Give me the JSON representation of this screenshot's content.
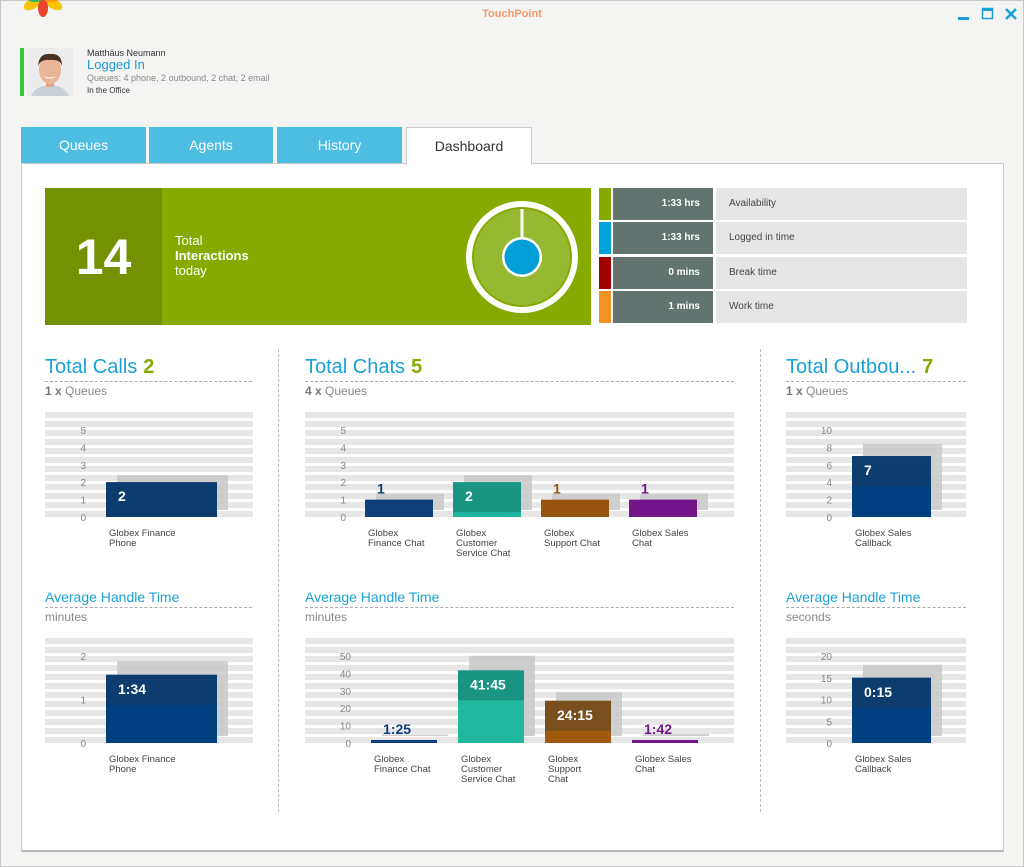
{
  "app": {
    "title": "TouchPoint"
  },
  "window_controls": {
    "minimize": "minimize",
    "maximize": "maximize",
    "close": "close"
  },
  "profile": {
    "name": "Matthäus Neumann",
    "status": "Logged In",
    "queues": "Queues: 4 phone, 2 outbound, 2 chat, 2 email",
    "location": "In the Office",
    "status_color": "#35c83a"
  },
  "tabs": [
    {
      "label": "Queues",
      "active": false
    },
    {
      "label": "Agents",
      "active": false
    },
    {
      "label": "History",
      "active": false
    },
    {
      "label": "Dashboard",
      "active": true
    }
  ],
  "summary": {
    "total": "14",
    "label_line1": "Total",
    "label_line2": "Interactions",
    "label_line3": "today",
    "color": "#86aa00"
  },
  "times": [
    {
      "value": "1:33 hrs",
      "label": "Availability",
      "color": "#86aa00"
    },
    {
      "value": "1:33 hrs",
      "label": "Logged in time",
      "color": "#00a3d9"
    },
    {
      "value": "0 mins",
      "label": "Break time",
      "color": "#a30000"
    },
    {
      "value": "1 mins",
      "label": "Work time",
      "color": "#f39323"
    }
  ],
  "sections": {
    "calls": {
      "title": "Total Calls",
      "count": "2",
      "queues_count": "1 x",
      "queues_label": "Queues",
      "aht_title": "Average Handle Time",
      "aht_unit": "minutes"
    },
    "chats": {
      "title": "Total Chats",
      "count": "5",
      "queues_count": "4 x",
      "queues_label": "Queues",
      "aht_title": "Average Handle Time",
      "aht_unit": "minutes"
    },
    "outbound": {
      "title": "Total Outbou...",
      "count": "7",
      "queues_count": "1 x",
      "queues_label": "Queues",
      "aht_title": "Average Handle Time",
      "aht_unit": "seconds"
    }
  },
  "chart_data": [
    {
      "id": "calls-count",
      "type": "bar",
      "title": "Total Calls",
      "categories": [
        "Globex Finance Phone"
      ],
      "labels": [
        [
          "Globex Finance",
          "Phone"
        ]
      ],
      "values": [
        2
      ],
      "value_labels": [
        "2"
      ],
      "colors": [
        "#0d3c6e"
      ],
      "colors_light": [
        "#0d3c6e"
      ],
      "ylim": [
        0,
        6
      ],
      "yticks": [
        0,
        1,
        2,
        3,
        4,
        5
      ],
      "label_inside": [
        true
      ]
    },
    {
      "id": "chats-count",
      "type": "bar",
      "title": "Total Chats",
      "categories": [
        "Globex Finance Chat",
        "Globex Customer Service Chat",
        "Globex Support Chat",
        "Globex Sales Chat"
      ],
      "labels": [
        [
          "Globex",
          "Finance Chat"
        ],
        [
          "Globex",
          "Customer",
          "Service Chat"
        ],
        [
          "Globex",
          "Support Chat"
        ],
        [
          "Globex Sales",
          "Chat"
        ]
      ],
      "values": [
        1,
        2,
        1,
        1
      ],
      "value_labels": [
        "1",
        "2",
        "1",
        "1"
      ],
      "colors": [
        "#0f3f78",
        "#1a9482",
        "#98550f",
        "#73168b"
      ],
      "colors_light": [
        "#0f3f78",
        "#1fb89f",
        "#98550f",
        "#73168b"
      ],
      "ylim": [
        0,
        6
      ],
      "yticks": [
        0,
        1,
        2,
        3,
        4,
        5
      ],
      "label_inside": [
        false,
        true,
        false,
        false
      ]
    },
    {
      "id": "outbound-count",
      "type": "bar",
      "title": "Total Outbound",
      "categories": [
        "Globex Sales Callback"
      ],
      "labels": [
        [
          "Globex Sales",
          "Callback"
        ]
      ],
      "values": [
        7
      ],
      "value_labels": [
        "7"
      ],
      "colors": [
        "#0d3c6e"
      ],
      "colors_light": [
        "#003f80"
      ],
      "ylim": [
        0,
        12
      ],
      "yticks": [
        0,
        2,
        4,
        6,
        8,
        10
      ],
      "label_inside": [
        true
      ]
    },
    {
      "id": "calls-aht",
      "type": "bar",
      "title": "Average Handle Time",
      "ylabel": "minutes",
      "categories": [
        "Globex Finance Phone"
      ],
      "labels": [
        [
          "Globex Finance",
          "Phone"
        ]
      ],
      "values": [
        1.567
      ],
      "value_labels": [
        "1:34"
      ],
      "colors": [
        "#0d3c6e"
      ],
      "colors_light": [
        "#003f80"
      ],
      "ylim": [
        0,
        2.5
      ],
      "yticks": [
        0,
        1,
        2
      ],
      "label_inside": [
        true
      ]
    },
    {
      "id": "chats-aht",
      "type": "bar",
      "title": "Average Handle Time",
      "ylabel": "minutes",
      "categories": [
        "Globex Finance Chat",
        "Globex Customer Service Chat",
        "Globex Support Chat",
        "Globex Sales Chat"
      ],
      "labels": [
        [
          "Globex",
          "Finance Chat"
        ],
        [
          "Globex",
          "Customer",
          "Service Chat"
        ],
        [
          "Globex",
          "Support",
          "Chat"
        ],
        [
          "Globex Sales",
          "Chat"
        ]
      ],
      "values": [
        1.417,
        41.75,
        24.25,
        1.7
      ],
      "value_labels": [
        "1:25",
        "41:45",
        "24:15",
        "1:42"
      ],
      "colors": [
        "#0f3f78",
        "#1a9482",
        "#7a4f1e",
        "#73168b"
      ],
      "colors_light": [
        "#0f3f78",
        "#1fb89f",
        "#a05a10",
        "#73168b"
      ],
      "ylim": [
        0,
        60
      ],
      "yticks": [
        0,
        10,
        20,
        30,
        40,
        50
      ],
      "label_inside": [
        false,
        true,
        true,
        false
      ]
    },
    {
      "id": "outbound-aht",
      "type": "bar",
      "title": "Average Handle Time",
      "ylabel": "seconds",
      "categories": [
        "Globex Sales Callback"
      ],
      "labels": [
        [
          "Globex Sales",
          "Callback"
        ]
      ],
      "values": [
        15
      ],
      "value_labels": [
        "0:15"
      ],
      "colors": [
        "#0d3c6e"
      ],
      "colors_light": [
        "#003f80"
      ],
      "ylim": [
        0,
        24
      ],
      "yticks": [
        0,
        5,
        10,
        15,
        20
      ],
      "label_inside": [
        true
      ]
    }
  ]
}
